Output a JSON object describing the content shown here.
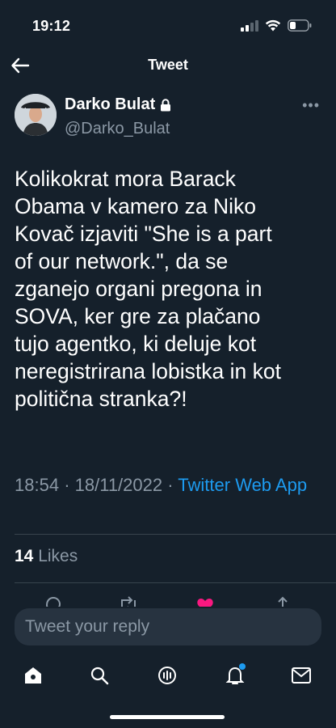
{
  "status_bar": {
    "time": "19:12"
  },
  "header": {
    "title": "Tweet"
  },
  "author": {
    "name": "Darko Bulat",
    "handle": "@Darko_Bulat"
  },
  "tweet": {
    "text": "Kolikokrat mora Barack\nObama v kamero za Niko\nKovač izjaviti \"She is a part\nof our network.\", da se\nzganejo organi pregona in\nSOVA, ker gre za plačano\ntujo agentko, ki deluje kot\nneregistrirana lobistka in kot\npolitična stranka?!",
    "time": "18:54",
    "date": "18/11/2022",
    "separator": "·",
    "source": "Twitter Web App"
  },
  "stats": {
    "likes_count": "14",
    "likes_label": "Likes"
  },
  "reply": {
    "placeholder": "Tweet your reply"
  },
  "tab_bar": {
    "items": [
      {
        "icon": "home-icon"
      },
      {
        "icon": "search-icon"
      },
      {
        "icon": "spaces-icon"
      },
      {
        "icon": "notifications-icon"
      },
      {
        "icon": "messages-icon"
      }
    ]
  },
  "colors": {
    "background": "#15202b",
    "accent": "#1d9bf0",
    "secondary_text": "#8b98a5",
    "like": "#f91880",
    "divider": "#38444d"
  }
}
